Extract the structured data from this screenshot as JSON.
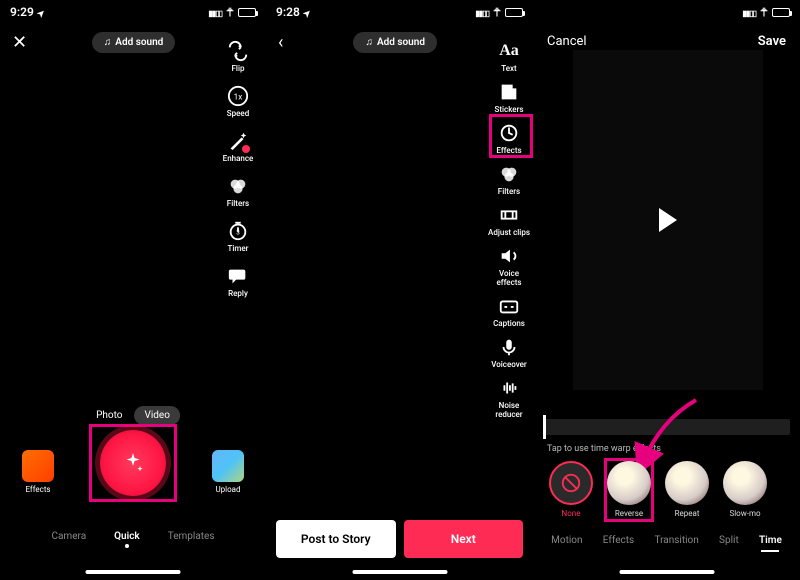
{
  "status": {
    "time1": "9:29",
    "time2": "9:28",
    "time3": ""
  },
  "screen1": {
    "add_sound": "Add sound",
    "tools": {
      "flip": "Flip",
      "speed": "Speed",
      "enhance": "Enhance",
      "filters": "Filters",
      "timer": "Timer",
      "reply": "Reply"
    },
    "modes": {
      "photo": "Photo",
      "video": "Video"
    },
    "effects": "Effects",
    "upload": "Upload",
    "tabs": {
      "camera": "Camera",
      "quick": "Quick",
      "templates": "Templates"
    }
  },
  "screen2": {
    "add_sound": "Add sound",
    "tools": {
      "text": "Text",
      "stickers": "Stickers",
      "effects": "Effects",
      "filters": "Filters",
      "adjust": "Adjust clips",
      "voice": "Voice effects",
      "captions": "Captions",
      "voiceover": "Voiceover",
      "noise": "Noise reducer"
    },
    "post_story": "Post to Story",
    "next": "Next"
  },
  "screen3": {
    "cancel": "Cancel",
    "save": "Save",
    "hint": "Tap to use time warp effects",
    "effects": {
      "none": "None",
      "reverse": "Reverse",
      "repeat": "Repeat",
      "slowmo": "Slow-mo"
    },
    "cats": {
      "motion": "Motion",
      "effects": "Effects",
      "transition": "Transition",
      "split": "Split",
      "time": "Time"
    }
  },
  "colors": {
    "accent": "#e6007e",
    "tiktok_red": "#fe2c55"
  }
}
